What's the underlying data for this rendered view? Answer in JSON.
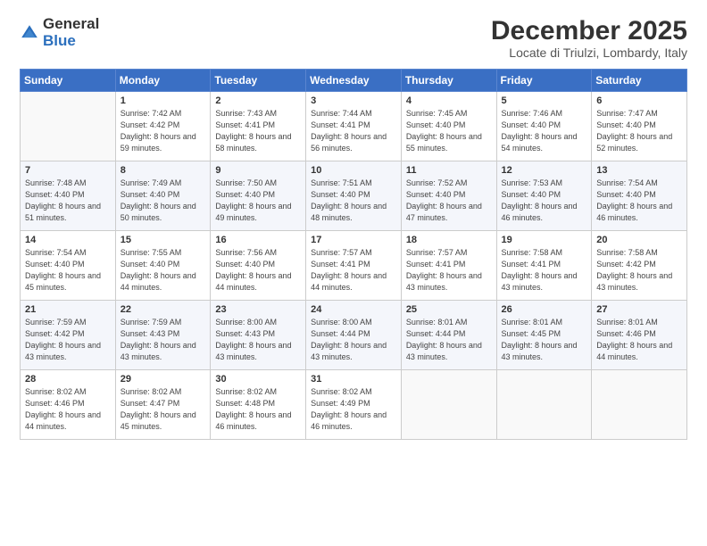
{
  "logo": {
    "general": "General",
    "blue": "Blue"
  },
  "title": "December 2025",
  "location": "Locate di Triulzi, Lombardy, Italy",
  "days_of_week": [
    "Sunday",
    "Monday",
    "Tuesday",
    "Wednesday",
    "Thursday",
    "Friday",
    "Saturday"
  ],
  "weeks": [
    [
      {
        "day": "",
        "sunrise": "",
        "sunset": "",
        "daylight": ""
      },
      {
        "day": "1",
        "sunrise": "Sunrise: 7:42 AM",
        "sunset": "Sunset: 4:42 PM",
        "daylight": "Daylight: 8 hours and 59 minutes."
      },
      {
        "day": "2",
        "sunrise": "Sunrise: 7:43 AM",
        "sunset": "Sunset: 4:41 PM",
        "daylight": "Daylight: 8 hours and 58 minutes."
      },
      {
        "day": "3",
        "sunrise": "Sunrise: 7:44 AM",
        "sunset": "Sunset: 4:41 PM",
        "daylight": "Daylight: 8 hours and 56 minutes."
      },
      {
        "day": "4",
        "sunrise": "Sunrise: 7:45 AM",
        "sunset": "Sunset: 4:40 PM",
        "daylight": "Daylight: 8 hours and 55 minutes."
      },
      {
        "day": "5",
        "sunrise": "Sunrise: 7:46 AM",
        "sunset": "Sunset: 4:40 PM",
        "daylight": "Daylight: 8 hours and 54 minutes."
      },
      {
        "day": "6",
        "sunrise": "Sunrise: 7:47 AM",
        "sunset": "Sunset: 4:40 PM",
        "daylight": "Daylight: 8 hours and 52 minutes."
      }
    ],
    [
      {
        "day": "7",
        "sunrise": "Sunrise: 7:48 AM",
        "sunset": "Sunset: 4:40 PM",
        "daylight": "Daylight: 8 hours and 51 minutes."
      },
      {
        "day": "8",
        "sunrise": "Sunrise: 7:49 AM",
        "sunset": "Sunset: 4:40 PM",
        "daylight": "Daylight: 8 hours and 50 minutes."
      },
      {
        "day": "9",
        "sunrise": "Sunrise: 7:50 AM",
        "sunset": "Sunset: 4:40 PM",
        "daylight": "Daylight: 8 hours and 49 minutes."
      },
      {
        "day": "10",
        "sunrise": "Sunrise: 7:51 AM",
        "sunset": "Sunset: 4:40 PM",
        "daylight": "Daylight: 8 hours and 48 minutes."
      },
      {
        "day": "11",
        "sunrise": "Sunrise: 7:52 AM",
        "sunset": "Sunset: 4:40 PM",
        "daylight": "Daylight: 8 hours and 47 minutes."
      },
      {
        "day": "12",
        "sunrise": "Sunrise: 7:53 AM",
        "sunset": "Sunset: 4:40 PM",
        "daylight": "Daylight: 8 hours and 46 minutes."
      },
      {
        "day": "13",
        "sunrise": "Sunrise: 7:54 AM",
        "sunset": "Sunset: 4:40 PM",
        "daylight": "Daylight: 8 hours and 46 minutes."
      }
    ],
    [
      {
        "day": "14",
        "sunrise": "Sunrise: 7:54 AM",
        "sunset": "Sunset: 4:40 PM",
        "daylight": "Daylight: 8 hours and 45 minutes."
      },
      {
        "day": "15",
        "sunrise": "Sunrise: 7:55 AM",
        "sunset": "Sunset: 4:40 PM",
        "daylight": "Daylight: 8 hours and 44 minutes."
      },
      {
        "day": "16",
        "sunrise": "Sunrise: 7:56 AM",
        "sunset": "Sunset: 4:40 PM",
        "daylight": "Daylight: 8 hours and 44 minutes."
      },
      {
        "day": "17",
        "sunrise": "Sunrise: 7:57 AM",
        "sunset": "Sunset: 4:41 PM",
        "daylight": "Daylight: 8 hours and 44 minutes."
      },
      {
        "day": "18",
        "sunrise": "Sunrise: 7:57 AM",
        "sunset": "Sunset: 4:41 PM",
        "daylight": "Daylight: 8 hours and 43 minutes."
      },
      {
        "day": "19",
        "sunrise": "Sunrise: 7:58 AM",
        "sunset": "Sunset: 4:41 PM",
        "daylight": "Daylight: 8 hours and 43 minutes."
      },
      {
        "day": "20",
        "sunrise": "Sunrise: 7:58 AM",
        "sunset": "Sunset: 4:42 PM",
        "daylight": "Daylight: 8 hours and 43 minutes."
      }
    ],
    [
      {
        "day": "21",
        "sunrise": "Sunrise: 7:59 AM",
        "sunset": "Sunset: 4:42 PM",
        "daylight": "Daylight: 8 hours and 43 minutes."
      },
      {
        "day": "22",
        "sunrise": "Sunrise: 7:59 AM",
        "sunset": "Sunset: 4:43 PM",
        "daylight": "Daylight: 8 hours and 43 minutes."
      },
      {
        "day": "23",
        "sunrise": "Sunrise: 8:00 AM",
        "sunset": "Sunset: 4:43 PM",
        "daylight": "Daylight: 8 hours and 43 minutes."
      },
      {
        "day": "24",
        "sunrise": "Sunrise: 8:00 AM",
        "sunset": "Sunset: 4:44 PM",
        "daylight": "Daylight: 8 hours and 43 minutes."
      },
      {
        "day": "25",
        "sunrise": "Sunrise: 8:01 AM",
        "sunset": "Sunset: 4:44 PM",
        "daylight": "Daylight: 8 hours and 43 minutes."
      },
      {
        "day": "26",
        "sunrise": "Sunrise: 8:01 AM",
        "sunset": "Sunset: 4:45 PM",
        "daylight": "Daylight: 8 hours and 43 minutes."
      },
      {
        "day": "27",
        "sunrise": "Sunrise: 8:01 AM",
        "sunset": "Sunset: 4:46 PM",
        "daylight": "Daylight: 8 hours and 44 minutes."
      }
    ],
    [
      {
        "day": "28",
        "sunrise": "Sunrise: 8:02 AM",
        "sunset": "Sunset: 4:46 PM",
        "daylight": "Daylight: 8 hours and 44 minutes."
      },
      {
        "day": "29",
        "sunrise": "Sunrise: 8:02 AM",
        "sunset": "Sunset: 4:47 PM",
        "daylight": "Daylight: 8 hours and 45 minutes."
      },
      {
        "day": "30",
        "sunrise": "Sunrise: 8:02 AM",
        "sunset": "Sunset: 4:48 PM",
        "daylight": "Daylight: 8 hours and 46 minutes."
      },
      {
        "day": "31",
        "sunrise": "Sunrise: 8:02 AM",
        "sunset": "Sunset: 4:49 PM",
        "daylight": "Daylight: 8 hours and 46 minutes."
      },
      {
        "day": "",
        "sunrise": "",
        "sunset": "",
        "daylight": ""
      },
      {
        "day": "",
        "sunrise": "",
        "sunset": "",
        "daylight": ""
      },
      {
        "day": "",
        "sunrise": "",
        "sunset": "",
        "daylight": ""
      }
    ]
  ]
}
